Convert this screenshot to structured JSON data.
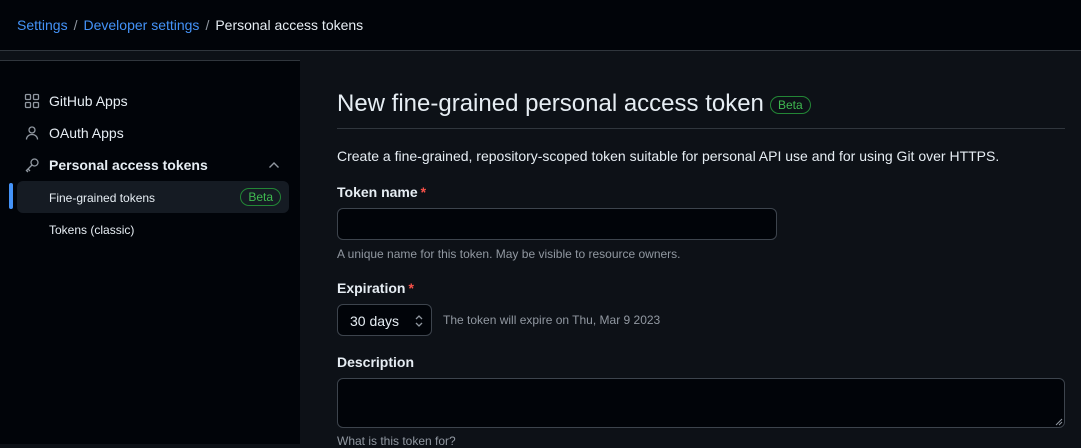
{
  "breadcrumb": {
    "settings": "Settings",
    "separator": "/",
    "developer_settings": "Developer settings",
    "current": "Personal access tokens"
  },
  "sidebar": {
    "items": [
      {
        "label": "GitHub Apps",
        "icon": "apps-grid-icon"
      },
      {
        "label": "OAuth Apps",
        "icon": "person-icon"
      },
      {
        "label": "Personal access tokens",
        "icon": "key-icon",
        "expanded": true
      }
    ],
    "subitems": [
      {
        "label": "Fine-grained tokens",
        "badge": "Beta",
        "active": true
      },
      {
        "label": "Tokens (classic)"
      }
    ]
  },
  "main": {
    "title": "New fine-grained personal access token",
    "title_badge": "Beta",
    "description": "Create a fine-grained, repository-scoped token suitable for personal API use and for using Git over HTTPS.",
    "token_name": {
      "label": "Token name",
      "required_mark": "*",
      "value": "",
      "hint": "A unique name for this token. May be visible to resource owners."
    },
    "expiration": {
      "label": "Expiration",
      "required_mark": "*",
      "selected": "30 days",
      "note": "The token will expire on Thu, Mar 9 2023"
    },
    "description_field": {
      "label": "Description",
      "value": "",
      "hint": "What is this token for?"
    }
  },
  "colors": {
    "background": "#0d1117",
    "sidebar_bg": "#010409",
    "link": "#4493f8",
    "badge_green": "#3fb950",
    "required_red": "#f85149",
    "muted_text": "#9198a1",
    "border": "#30363d"
  }
}
